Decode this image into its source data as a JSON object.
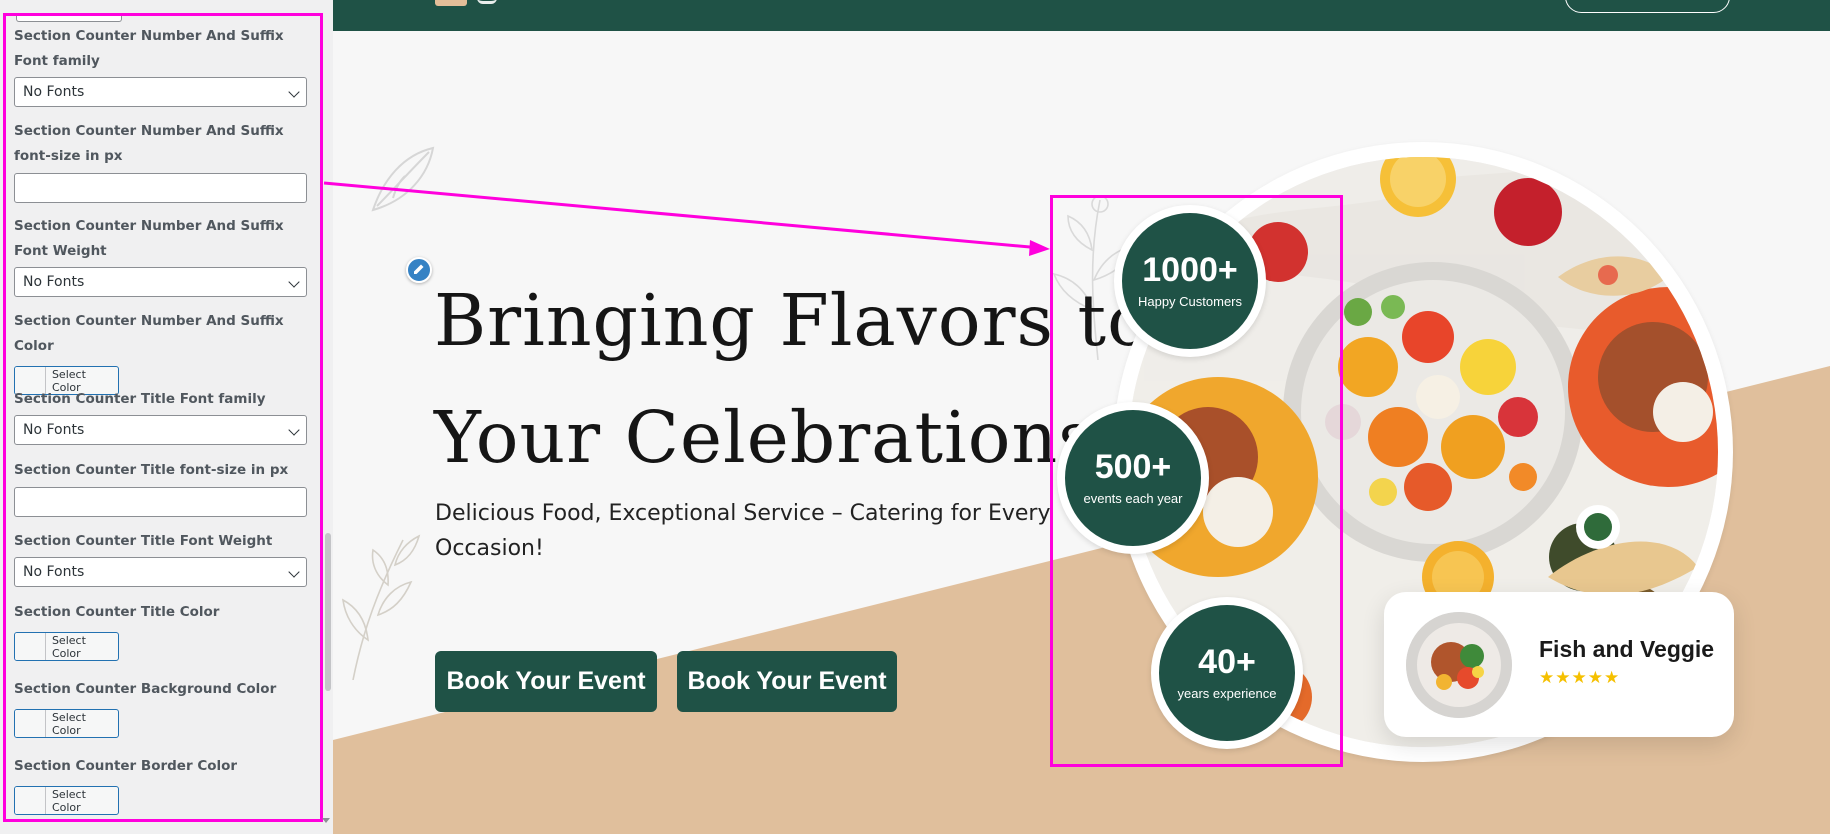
{
  "panel": {
    "fields": [
      {
        "label": "Section Counter Number And Suffix Font family",
        "type": "select",
        "value": "No Fonts"
      },
      {
        "label": "Section Counter Number And Suffix font-size in px",
        "type": "text",
        "value": ""
      },
      {
        "label": "Section Counter Number And Suffix Font Weight",
        "type": "select",
        "value": "No Fonts"
      },
      {
        "label": "Section Counter Number And Suffix Color",
        "type": "color",
        "button": "Select Color"
      },
      {
        "label": "Section Counter Title Font family",
        "type": "select",
        "value": "No Fonts"
      },
      {
        "label": "Section Counter Title font-size in px",
        "type": "text",
        "value": ""
      },
      {
        "label": "Section Counter Title Font Weight",
        "type": "select",
        "value": "No Fonts"
      },
      {
        "label": "Section Counter Title Color",
        "type": "color",
        "button": "Select Color"
      },
      {
        "label": "Section Counter Background Color",
        "type": "color",
        "button": "Select Color"
      },
      {
        "label": "Section Counter Border Color",
        "type": "color",
        "button": "Select Color"
      }
    ]
  },
  "hero": {
    "title_line1": "Bringing Flavors to",
    "title_line2": "Your Celebrations",
    "subtitle": "Delicious Food, Exceptional Service – Catering for Every Occasion!",
    "button1": "Book Your Event",
    "button2": "Book Your Event"
  },
  "counters": [
    {
      "number": "1000+",
      "title": "Happy Customers"
    },
    {
      "number": "500+",
      "title": "events each year"
    },
    {
      "number": "40+",
      "title": "years experience"
    }
  ],
  "card": {
    "title": "Fish and Veggie",
    "rating": "★★★★★"
  },
  "colors": {
    "brand_green": "#1f5246",
    "tan": "#e0bf9c",
    "highlight_magenta": "#ff00dd",
    "star": "#f5c000",
    "wp_blue": "#2271b1"
  },
  "icons": [
    "chevron-down-icon",
    "pencil-icon",
    "star-icon",
    "arrow-annotation"
  ]
}
